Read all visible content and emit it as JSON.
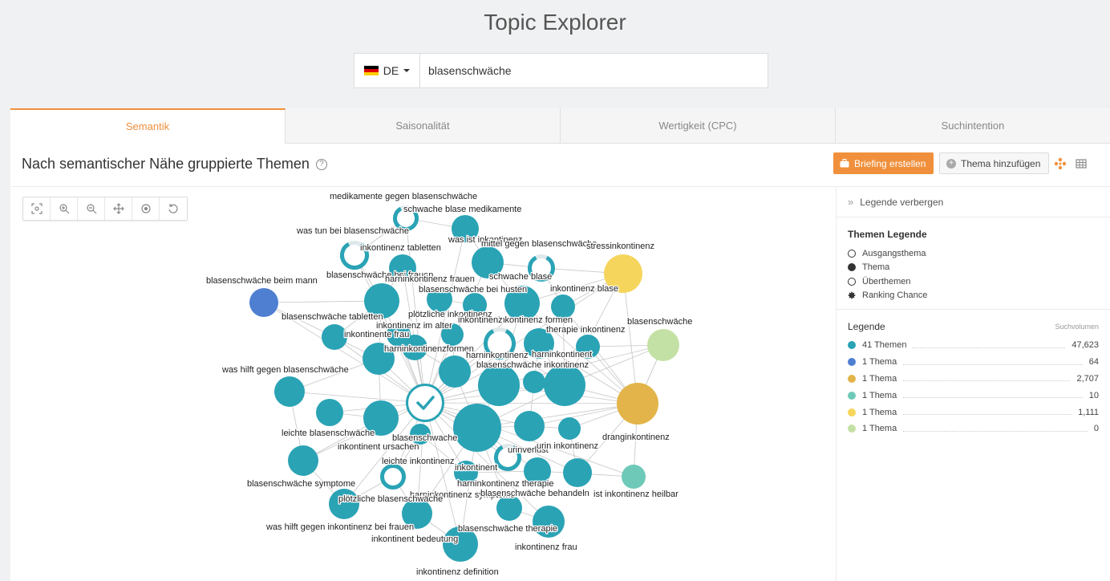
{
  "app": {
    "title": "Topic Explorer"
  },
  "search": {
    "lang": "DE",
    "value": "blasenschwäche",
    "lang_flag_colors": [
      "#000000",
      "#dd0000",
      "#ffce00"
    ]
  },
  "tabs": [
    {
      "label": "Semantik",
      "active": true
    },
    {
      "label": "Saisonalität",
      "active": false
    },
    {
      "label": "Wertigkeit (CPC)",
      "active": false
    },
    {
      "label": "Suchintention",
      "active": false
    }
  ],
  "panel": {
    "title": "Nach semantischer Nähe gruppierte Themen",
    "briefing_label": "Briefing erstellen",
    "add_topic_label": "Thema hinzufügen"
  },
  "toolbar_icons": [
    "fit-screen-icon",
    "zoom-in-icon",
    "zoom-out-icon",
    "center-icon",
    "focus-icon",
    "reset-icon"
  ],
  "legend": {
    "toggle_label": "Legende verbergen",
    "themes_heading": "Themen Legende",
    "themes_items": [
      {
        "label": "Ausgangsthema",
        "symbol": "ring"
      },
      {
        "label": "Thema",
        "symbol": "dot"
      },
      {
        "label": "Überthemen",
        "symbol": "ring"
      },
      {
        "label": "Ranking Chance",
        "symbol": "star"
      }
    ],
    "heading": "Legende",
    "volume_label": "Suchvolumen",
    "rows": [
      {
        "color": "#2aa3b5",
        "label": "41 Themen",
        "value": "47,623"
      },
      {
        "color": "#4f7fd1",
        "label": "1 Thema",
        "value": "64"
      },
      {
        "color": "#e3b44a",
        "label": "1 Thema",
        "value": "2,707"
      },
      {
        "color": "#6ec9b8",
        "label": "1 Thema",
        "value": "10"
      },
      {
        "color": "#f6d55c",
        "label": "1 Thema",
        "value": "1,111"
      },
      {
        "color": "#c4e1a5",
        "label": "1 Thema",
        "value": "0"
      }
    ]
  },
  "graph": {
    "colors": {
      "teal": "#2aa3b5",
      "blue": "#4f7fd1",
      "gold": "#e3b44a",
      "mint": "#6ec9b8",
      "yellow": "#f6d55c",
      "lime": "#c4e1a5",
      "edge": "#c6c6c6"
    },
    "labels": [
      "medikamente gegen blasenschwäche",
      "schwache blase medikamente",
      "was tun bei blasenschwäche",
      "was ist inkontinenz",
      "mittel gegen blasenschwäche",
      "stressinkontinenz",
      "inkontinenz tabletten",
      "blasenschwäche bei frauen",
      "harninkontinenz frauen",
      "schwache blase",
      "blasenschwäche beim mann",
      "blasenschwäche bei husten",
      "inkontinenz blase",
      "plötzliche inkontinenz",
      "blasenschwäche tabletten",
      "inkontinenz formen",
      "inkontinenz",
      "inkontinenz im alter",
      "therapie inkontinenz",
      "blasenschwäche",
      "inkontinente frau",
      "harninkontinenzformen",
      "harninkontinenz",
      "harninkontinent",
      "blasenschwäche inkontinenz",
      "was hilft gegen blasenschwäche",
      "leichte blasenschwäche",
      "blasenschwache",
      "inkontinent ursachen",
      "urinverlust",
      "urin inkontinenz",
      "dranginkontinenz",
      "leichte inkontinenz",
      "inkontinent",
      "blasenschwäche symptome",
      "harninkontinenz therapie",
      "harninkontinenz symptome",
      "plötzliche blasenschwäche",
      "blasenschwäche behandeln",
      "ist inkontinenz heilbar",
      "was hilft gegen inkontinenz bei frauen",
      "blasenschwäche therapie",
      "inkontinent bedeutung",
      "inkontinenz frau",
      "inkontinenz definition"
    ]
  }
}
